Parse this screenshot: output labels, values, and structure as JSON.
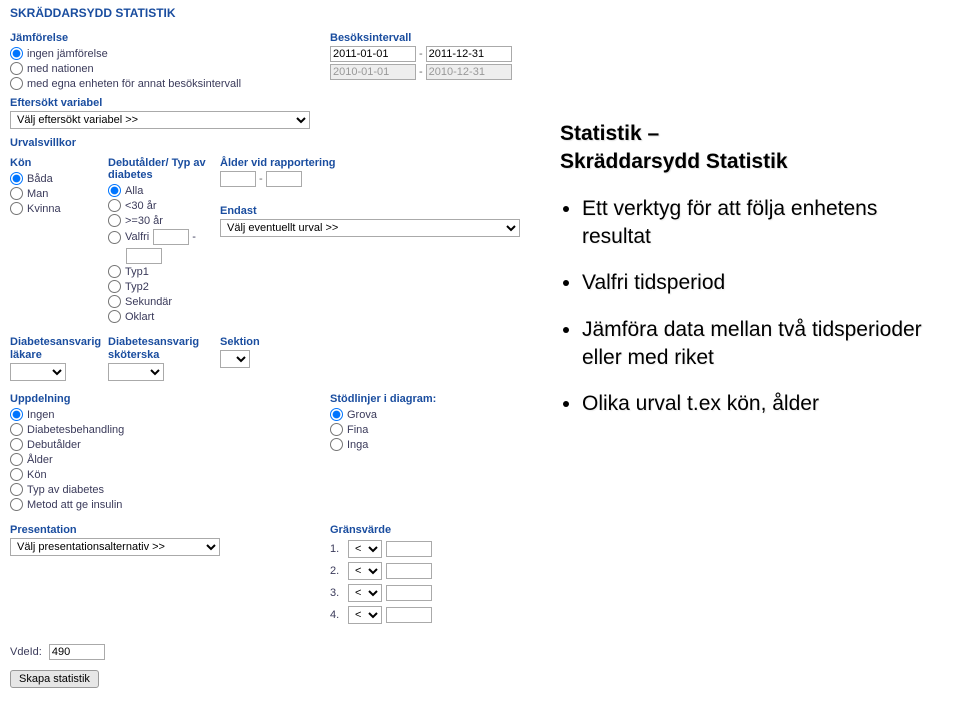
{
  "title": "SKRÄDDARSYDD STATISTIK",
  "jamforelse": {
    "label": "Jämförelse",
    "opts": [
      "ingen jämförelse",
      "med nationen",
      "med egna enheten för annat besöksintervall"
    ]
  },
  "besoksintervall": {
    "label": "Besöksintervall",
    "d1a": "2011-01-01",
    "d1b": "2011-12-31",
    "d2a": "2010-01-01",
    "d2b": "2010-12-31"
  },
  "eftersokt": {
    "label": "Eftersökt variabel",
    "select": "Välj eftersökt variabel >>"
  },
  "urvalsvillkor": "Urvalsvillkor",
  "kon": {
    "label": "Kön",
    "opts": [
      "Båda",
      "Man",
      "Kvinna"
    ]
  },
  "debut": {
    "label": "Debutålder/ Typ av diabetes",
    "opts": [
      "Alla",
      "<30 år",
      ">=30 år",
      "Valfri"
    ],
    "typeopts": [
      "Typ1",
      "Typ2",
      "Sekundär",
      "Oklart"
    ]
  },
  "alder_rap": {
    "label": "Ålder vid rapportering"
  },
  "endast": {
    "label": "Endast",
    "select": "Välj eventuellt urval >>"
  },
  "diab_lak": "Diabetesansvarig läkare",
  "diab_skot": "Diabetesansvarig sköterska",
  "sektion": "Sektion",
  "uppdelning": {
    "label": "Uppdelning",
    "opts": [
      "Ingen",
      "Diabetesbehandling",
      "Debutålder",
      "Ålder",
      "Kön",
      "Typ av diabetes",
      "Metod att ge insulin"
    ]
  },
  "stodlinjer": {
    "label": "Stödlinjer i diagram:",
    "opts": [
      "Grova",
      "Fina",
      "Inga"
    ]
  },
  "presentation": {
    "label": "Presentation",
    "select": "Välj presentationsalternativ >>"
  },
  "gransvarde": {
    "label": "Gränsvärde",
    "nums": [
      "1.",
      "2.",
      "3.",
      "4."
    ],
    "op": "<"
  },
  "vdeid": {
    "label": "VdeId:",
    "value": "490"
  },
  "skapa": "Skapa statistik",
  "side": {
    "h1": "Statistik –",
    "h2": "Skräddarsydd Statistik",
    "b1": "Ett verktyg för att följa enhetens resultat",
    "b2": "Valfri tidsperiod",
    "b3": "Jämföra data mellan två tidsperioder eller med riket",
    "b4": "Olika urval t.ex kön, ålder"
  }
}
